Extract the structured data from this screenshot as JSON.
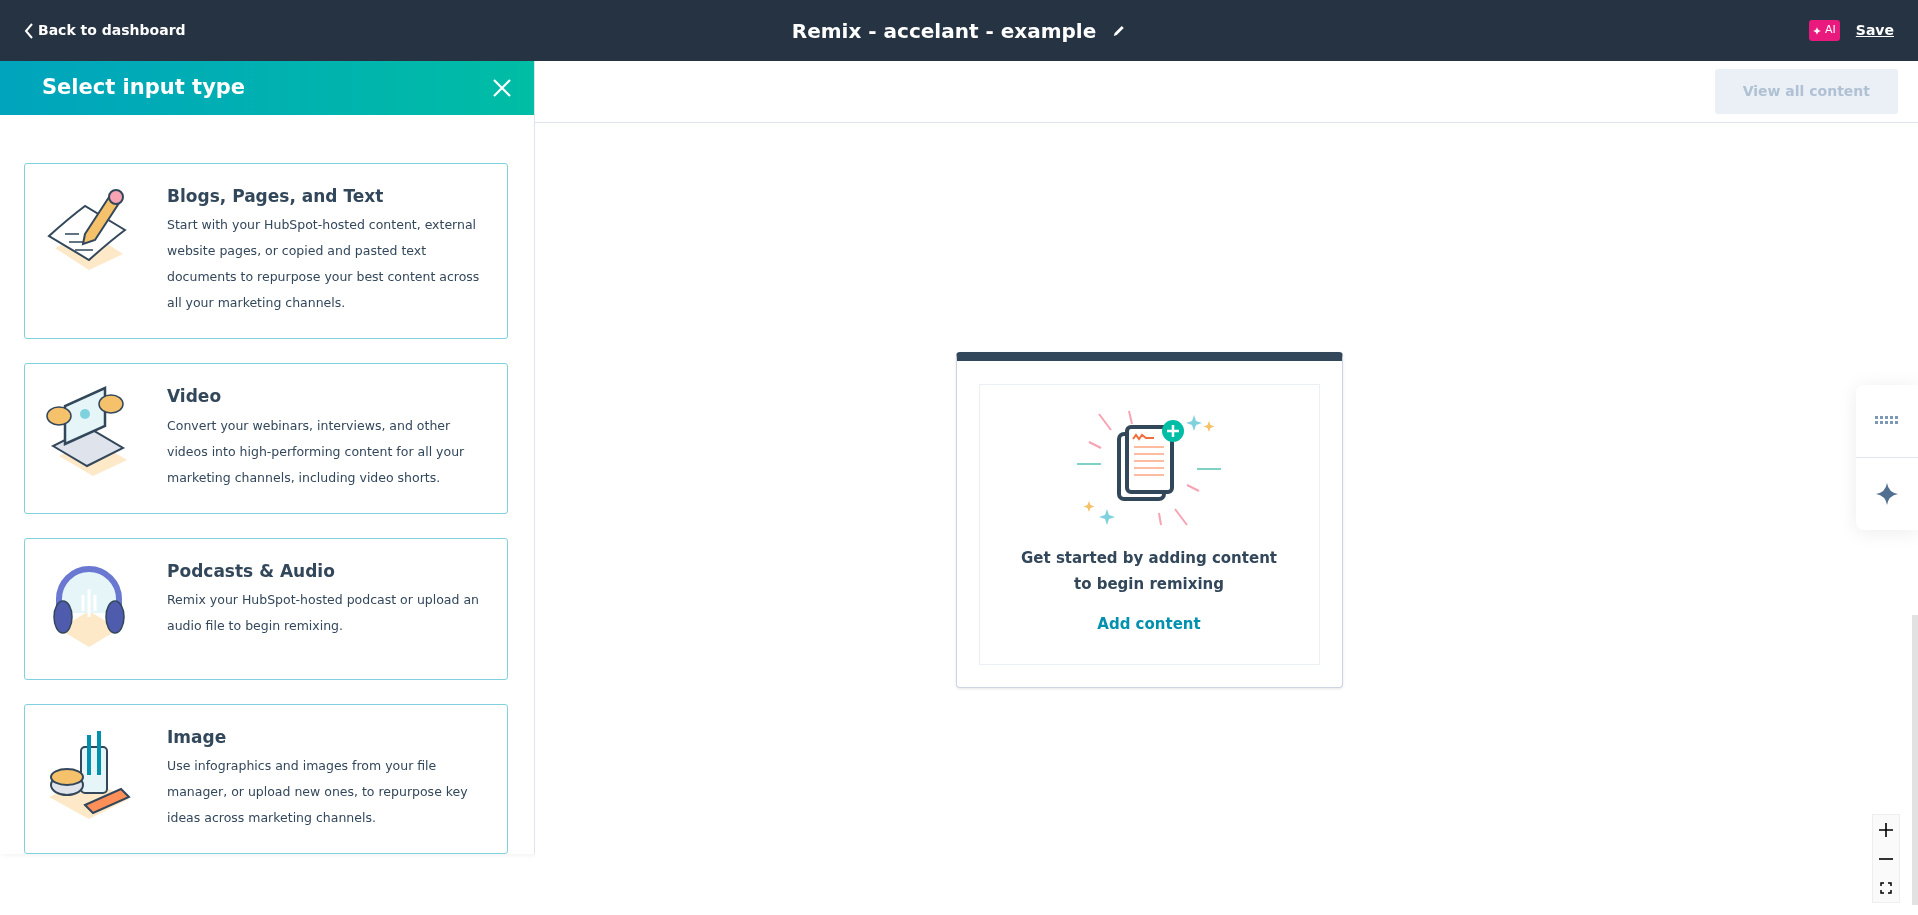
{
  "topbar": {
    "back_link": "Back to dashboard",
    "title": "Remix - accelant - example",
    "ai_badge": "AI",
    "save": "Save"
  },
  "panel": {
    "title": "Select input type",
    "options": [
      {
        "kind": "text",
        "title": "Blogs, Pages, and Text",
        "description": "Start with your HubSpot-hosted content, external website pages, or copied and pasted text documents to repurpose your best content across all your marketing channels."
      },
      {
        "kind": "video",
        "title": "Video",
        "description": "Convert your webinars, interviews, and other videos into high-performing content for all your marketing channels, including video shorts."
      },
      {
        "kind": "audio",
        "title": "Podcasts & Audio",
        "description": "Remix your HubSpot-hosted podcast or upload an audio file to begin remixing."
      },
      {
        "kind": "image",
        "title": "Image",
        "description": "Use infographics and images from your file manager, or upload new ones, to repurpose key ideas across marketing channels."
      }
    ]
  },
  "canvas": {
    "view_all_button": {
      "label": "View all content",
      "disabled": true
    },
    "empty_card": {
      "message": "Get started by adding content to begin remixing",
      "action": "Add content"
    }
  }
}
